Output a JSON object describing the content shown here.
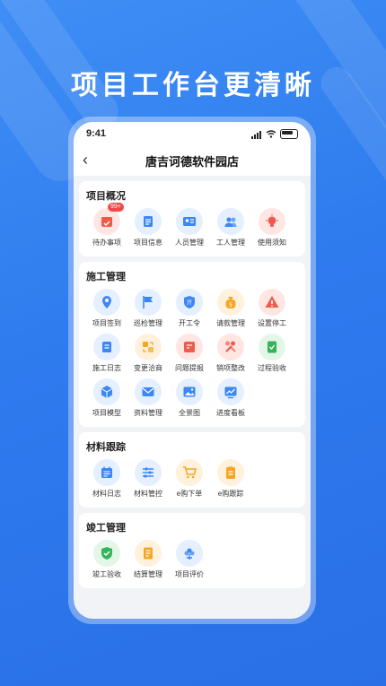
{
  "headline": "项目工作台更清晰",
  "status": {
    "time": "9:41"
  },
  "nav": {
    "title": "唐吉诃德软件园店"
  },
  "sections": [
    {
      "title": "项目概况",
      "items": [
        {
          "label": "待办事项",
          "badge": "99+",
          "icon": "calendar-icon",
          "color": "red"
        },
        {
          "label": "项目信息",
          "icon": "document-icon",
          "color": "blue"
        },
        {
          "label": "人员管理",
          "icon": "id-card-icon",
          "color": "blue"
        },
        {
          "label": "工人管理",
          "icon": "users-icon",
          "color": "blue"
        },
        {
          "label": "使用须知",
          "icon": "lightbulb-icon",
          "color": "red"
        }
      ]
    },
    {
      "title": "施工管理",
      "items": [
        {
          "label": "项目签到",
          "icon": "location-icon",
          "color": "blue"
        },
        {
          "label": "巡检管理",
          "icon": "flag-icon",
          "color": "blue"
        },
        {
          "label": "开工令",
          "icon": "shield-icon",
          "color": "blue"
        },
        {
          "label": "请款管理",
          "icon": "money-bag-icon",
          "color": "orange"
        },
        {
          "label": "设置停工",
          "icon": "warning-icon",
          "color": "red"
        },
        {
          "label": "施工日志",
          "icon": "notebook-icon",
          "color": "blue"
        },
        {
          "label": "变更洽商",
          "icon": "change-icon",
          "color": "orange"
        },
        {
          "label": "问题提报",
          "icon": "report-icon",
          "color": "red"
        },
        {
          "label": "销项整改",
          "icon": "tools-icon",
          "color": "red"
        },
        {
          "label": "过程验收",
          "icon": "checklist-icon",
          "color": "green"
        },
        {
          "label": "项目模型",
          "icon": "cube-icon",
          "color": "blue"
        },
        {
          "label": "资料管理",
          "icon": "mail-icon",
          "color": "blue"
        },
        {
          "label": "全景图",
          "icon": "image-icon",
          "color": "blue"
        },
        {
          "label": "进度看板",
          "icon": "trend-icon",
          "color": "blue"
        }
      ]
    },
    {
      "title": "材料跟踪",
      "items": [
        {
          "label": "材料日志",
          "icon": "calendar-list-icon",
          "color": "blue"
        },
        {
          "label": "材料管控",
          "icon": "sliders-icon",
          "color": "blue"
        },
        {
          "label": "e购下单",
          "icon": "cart-icon",
          "color": "orange"
        },
        {
          "label": "e购跟踪",
          "icon": "clipboard-icon",
          "color": "orange"
        }
      ]
    },
    {
      "title": "竣工管理",
      "items": [
        {
          "label": "竣工验收",
          "icon": "shield-check-icon",
          "color": "green"
        },
        {
          "label": "结算管理",
          "icon": "ledger-icon",
          "color": "orange"
        },
        {
          "label": "项目评价",
          "icon": "flower-icon",
          "color": "blue"
        }
      ]
    }
  ]
}
